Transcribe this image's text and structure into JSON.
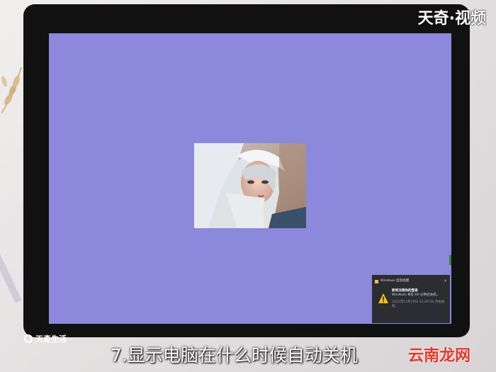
{
  "watermarks": {
    "top_right": "天奇·视频",
    "bottom_left": "天奇生活",
    "bottom_right": "云南龙网"
  },
  "subtitle": "7.显示电脑在什么时候自动关机",
  "notification": {
    "app_name": "Windows 自动提醒",
    "title": "即将注销你的登录",
    "message": "Windows 将在 60 分钟后关机。",
    "time": "2021年12月10日 12:20:56 开始关机。",
    "close_icon": "×"
  },
  "colors": {
    "screen": "#8c88db",
    "bezel": "#111111",
    "warning": "#f5c40f",
    "notification_bg": "#2b2d33",
    "bottom_right_watermark": "#e23a2c"
  }
}
